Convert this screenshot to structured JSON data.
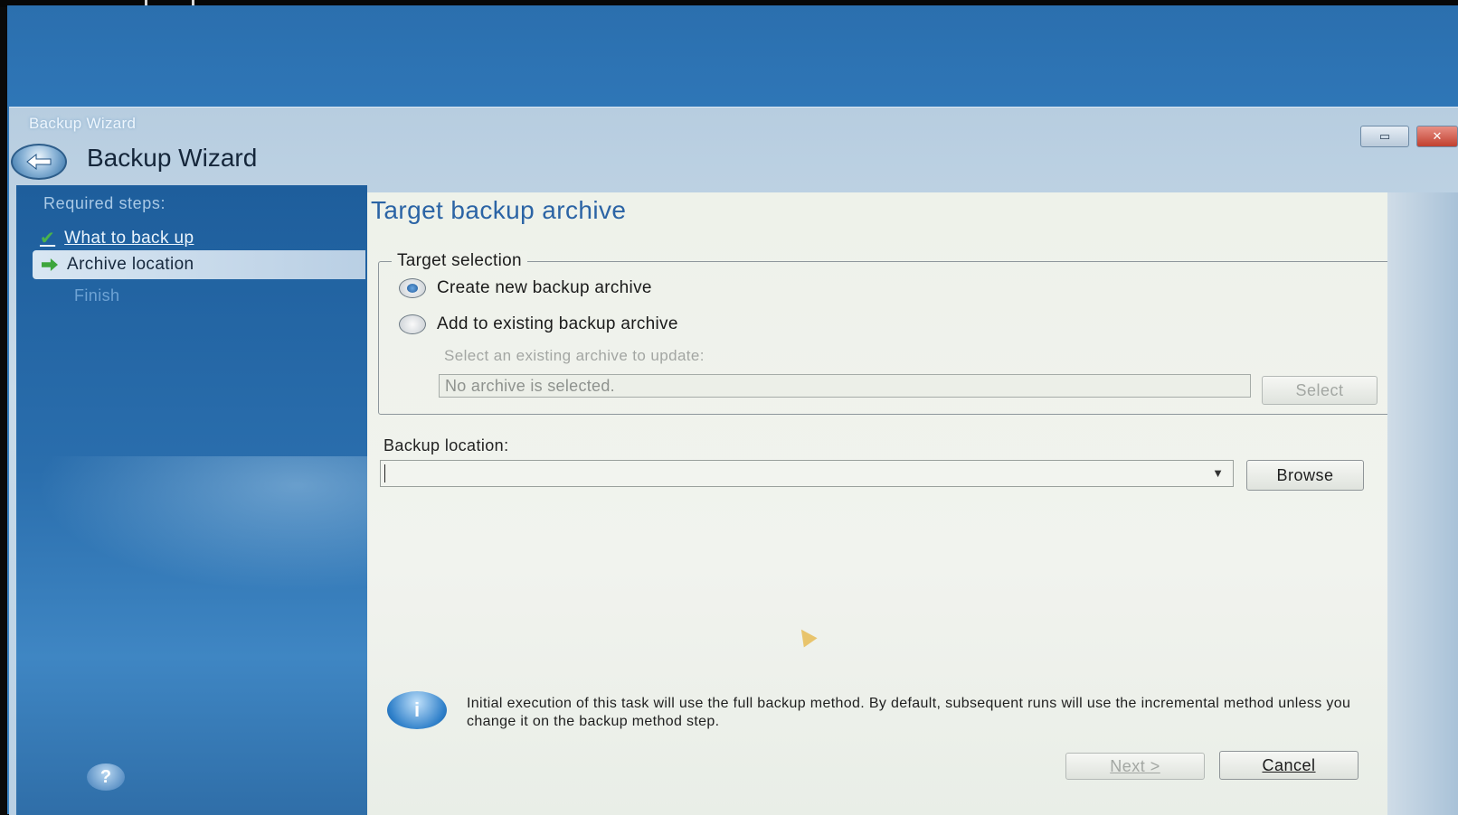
{
  "window": {
    "caption": "Backup Wizard",
    "title": "Backup Wizard",
    "buttons": [
      "restore",
      "close"
    ]
  },
  "sidebar": {
    "heading": "Required steps:",
    "steps": [
      {
        "label": "What to back up",
        "state": "completed",
        "icon": "checkmark-icon"
      },
      {
        "label": "Archive location",
        "state": "current",
        "icon": "green-arrow-icon"
      },
      {
        "label": "Finish",
        "state": "pending"
      }
    ],
    "help_icon": "help-icon"
  },
  "main": {
    "title": "Target backup archive",
    "target_selection": {
      "legend": "Target selection",
      "options": [
        {
          "label": "Create new backup archive",
          "selected": true
        },
        {
          "label": "Add to existing backup archive",
          "selected": false
        }
      ],
      "hint": "Select an existing archive to update:",
      "archive_value": "No archive is selected.",
      "select_button": "Select"
    },
    "backup_location": {
      "label": "Backup location:",
      "value": "",
      "browse_button": "Browse"
    },
    "info": {
      "icon": "info-icon",
      "text": "Initial execution of this task will use the full backup method. By default, subsequent runs will use the incremental method unless you change it on the backup method step."
    }
  },
  "footer": {
    "next_label": "Next >",
    "cancel_label": "Cancel"
  },
  "colors": {
    "desktop_blue": "#2f77b8",
    "sidebar_blue": "#2a6ead",
    "title_blue": "#2b64a5",
    "content_bg": "#eef2ea"
  }
}
